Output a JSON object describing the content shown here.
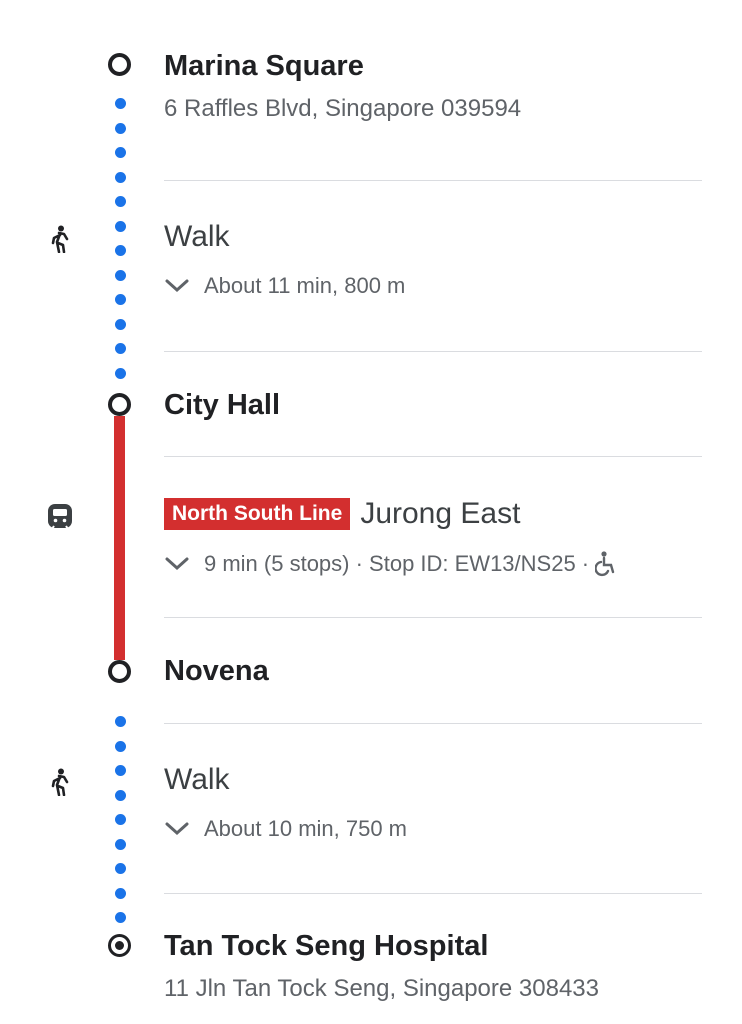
{
  "colors": {
    "walk_dots": "#1a73e8",
    "line": "#d32f2f",
    "text": "#202124",
    "muted": "#5f6368"
  },
  "origin": {
    "name": "Marina Square",
    "address": "6 Raffles Blvd, Singapore 039594"
  },
  "walk1": {
    "mode": "Walk",
    "detail": "About 11 min, 800 m",
    "icon": "walk-icon"
  },
  "stop1": {
    "name": "City Hall"
  },
  "transit": {
    "line": "North South Line",
    "headsign": "Jurong East",
    "detail": "9 min (5 stops) · Stop ID: EW13/NS25 ·",
    "icon": "subway-icon",
    "accessibility_icon": "wheelchair-icon"
  },
  "stop2": {
    "name": "Novena"
  },
  "walk2": {
    "mode": "Walk",
    "detail": "About 10 min, 750 m",
    "icon": "walk-icon"
  },
  "destination": {
    "name": "Tan Tock Seng Hospital",
    "address": "11 Jln Tan Tock Seng, Singapore 308433"
  }
}
